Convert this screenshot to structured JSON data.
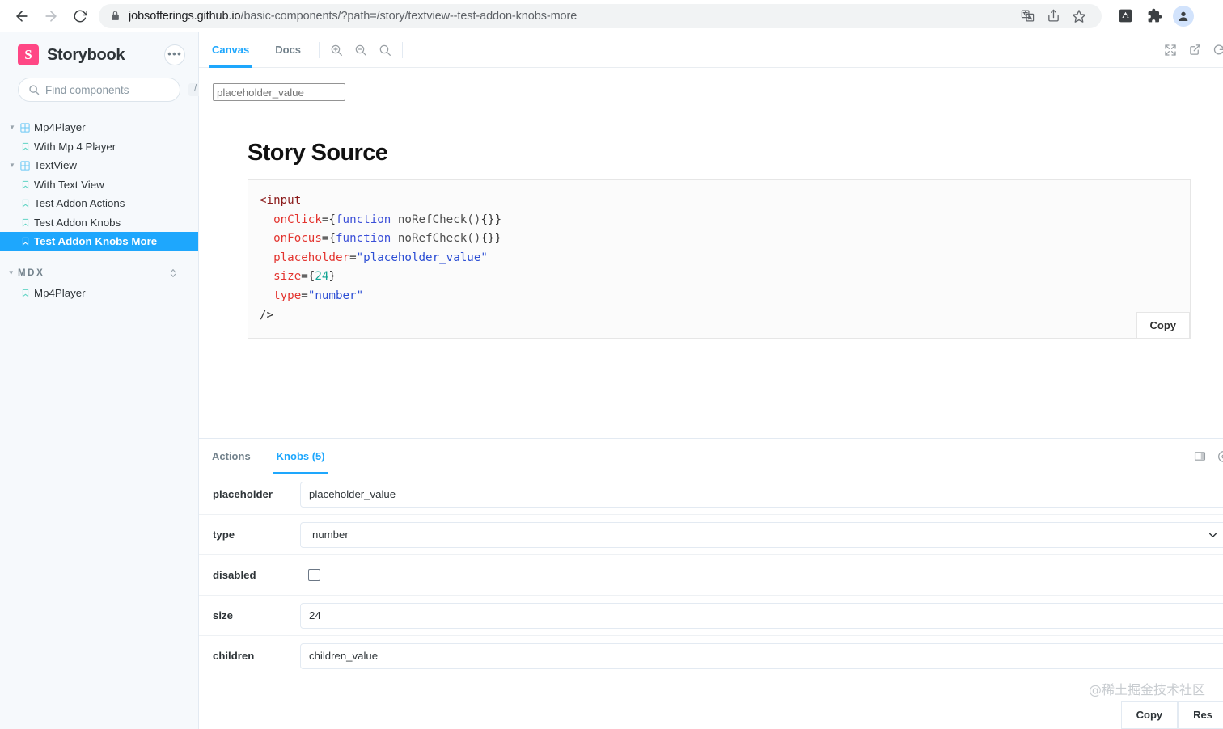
{
  "browser": {
    "url_domain": "jobsofferings.github.io",
    "url_path": "/basic-components/?path=/story/textview--test-addon-knobs-more",
    "back_icon": "back-arrow-icon",
    "forward_icon": "forward-arrow-icon",
    "reload_icon": "reload-icon",
    "lock_icon": "lock-icon",
    "translate_icon": "translate-icon",
    "share_icon": "share-icon",
    "bookmark_icon": "star-icon",
    "extension_icon": "extension-icon",
    "puzzle_icon": "puzzle-icon",
    "profile_icon": "profile-avatar-icon"
  },
  "sidebar": {
    "brand": "Storybook",
    "logo_letter": "S",
    "logo_color": "#ff4785",
    "menu_label": "•••",
    "search": {
      "placeholder": "Find components",
      "value": "",
      "shortcut": "/"
    },
    "tree": [
      {
        "label": "Mp4Player",
        "type": "component",
        "level": 1,
        "expanded": true,
        "selected": false
      },
      {
        "label": "With Mp 4 Player",
        "type": "story",
        "level": 2,
        "selected": false
      },
      {
        "label": "TextView",
        "type": "component",
        "level": 1,
        "expanded": true,
        "selected": false
      },
      {
        "label": "With Text View",
        "type": "story",
        "level": 2,
        "selected": false
      },
      {
        "label": "Test Addon Actions",
        "type": "story",
        "level": 2,
        "selected": false
      },
      {
        "label": "Test Addon Knobs",
        "type": "story",
        "level": 2,
        "selected": false
      },
      {
        "label": "Test Addon Knobs More",
        "type": "story",
        "level": 2,
        "selected": true
      }
    ],
    "section": {
      "label": "MDX",
      "expanded": true
    },
    "section_items": [
      {
        "label": "Mp4Player",
        "type": "story",
        "level": 1,
        "selected": false
      }
    ],
    "selected_color": "#1ea7fd"
  },
  "toolbar": {
    "tabs": [
      {
        "label": "Canvas",
        "active": true
      },
      {
        "label": "Docs",
        "active": false
      }
    ],
    "zoom_in_icon": "zoom-in-icon",
    "zoom_out_icon": "zoom-out-icon",
    "zoom_reset_icon": "zoom-reset-icon",
    "fullscreen_icon": "fullscreen-icon",
    "open-new-tab_icon": "open-in-new-tab-icon",
    "refresh_icon": "refresh-icon",
    "accent_color": "#1ea7fd"
  },
  "preview": {
    "rendered_input_placeholder": "placeholder_value",
    "source_title": "Story Source",
    "copy_label": "Copy",
    "code_lines": [
      [
        {
          "t": "tag",
          "v": "<input"
        }
      ],
      [
        {
          "t": "plain",
          "v": "  "
        },
        {
          "t": "attr",
          "v": "onClick"
        },
        {
          "t": "punct",
          "v": "={"
        },
        {
          "t": "kw",
          "v": "function"
        },
        {
          "t": "fn",
          "v": " noRefCheck()"
        },
        {
          "t": "punct",
          "v": "{}}"
        }
      ],
      [
        {
          "t": "plain",
          "v": "  "
        },
        {
          "t": "attr",
          "v": "onFocus"
        },
        {
          "t": "punct",
          "v": "={"
        },
        {
          "t": "kw",
          "v": "function"
        },
        {
          "t": "fn",
          "v": " noRefCheck()"
        },
        {
          "t": "punct",
          "v": "{}}"
        }
      ],
      [
        {
          "t": "plain",
          "v": "  "
        },
        {
          "t": "attr",
          "v": "placeholder"
        },
        {
          "t": "punct",
          "v": "="
        },
        {
          "t": "str",
          "v": "\"placeholder_value\""
        }
      ],
      [
        {
          "t": "plain",
          "v": "  "
        },
        {
          "t": "attr",
          "v": "size"
        },
        {
          "t": "punct",
          "v": "={"
        },
        {
          "t": "num",
          "v": "24"
        },
        {
          "t": "punct",
          "v": "}"
        }
      ],
      [
        {
          "t": "plain",
          "v": "  "
        },
        {
          "t": "attr",
          "v": "type"
        },
        {
          "t": "punct",
          "v": "="
        },
        {
          "t": "str",
          "v": "\"number\""
        }
      ],
      [
        {
          "t": "punct",
          "v": "/>"
        }
      ]
    ]
  },
  "panel": {
    "tabs": [
      {
        "label": "Actions",
        "active": false
      },
      {
        "label": "Knobs (5)",
        "active": true
      }
    ],
    "layout_icon": "panel-position-icon",
    "settings_icon": "settings-circle-icon",
    "knobs": [
      {
        "label": "placeholder",
        "control": "text",
        "value": "placeholder_value"
      },
      {
        "label": "type",
        "control": "select",
        "value": "number"
      },
      {
        "label": "disabled",
        "control": "checkbox",
        "value": "",
        "checked": false
      },
      {
        "label": "size",
        "control": "text",
        "value": "24"
      },
      {
        "label": "children",
        "control": "text",
        "value": "children_value"
      }
    ],
    "footer": {
      "copy_label": "Copy",
      "reset_label": "Res"
    }
  },
  "watermark": "@稀土掘金技术社区"
}
